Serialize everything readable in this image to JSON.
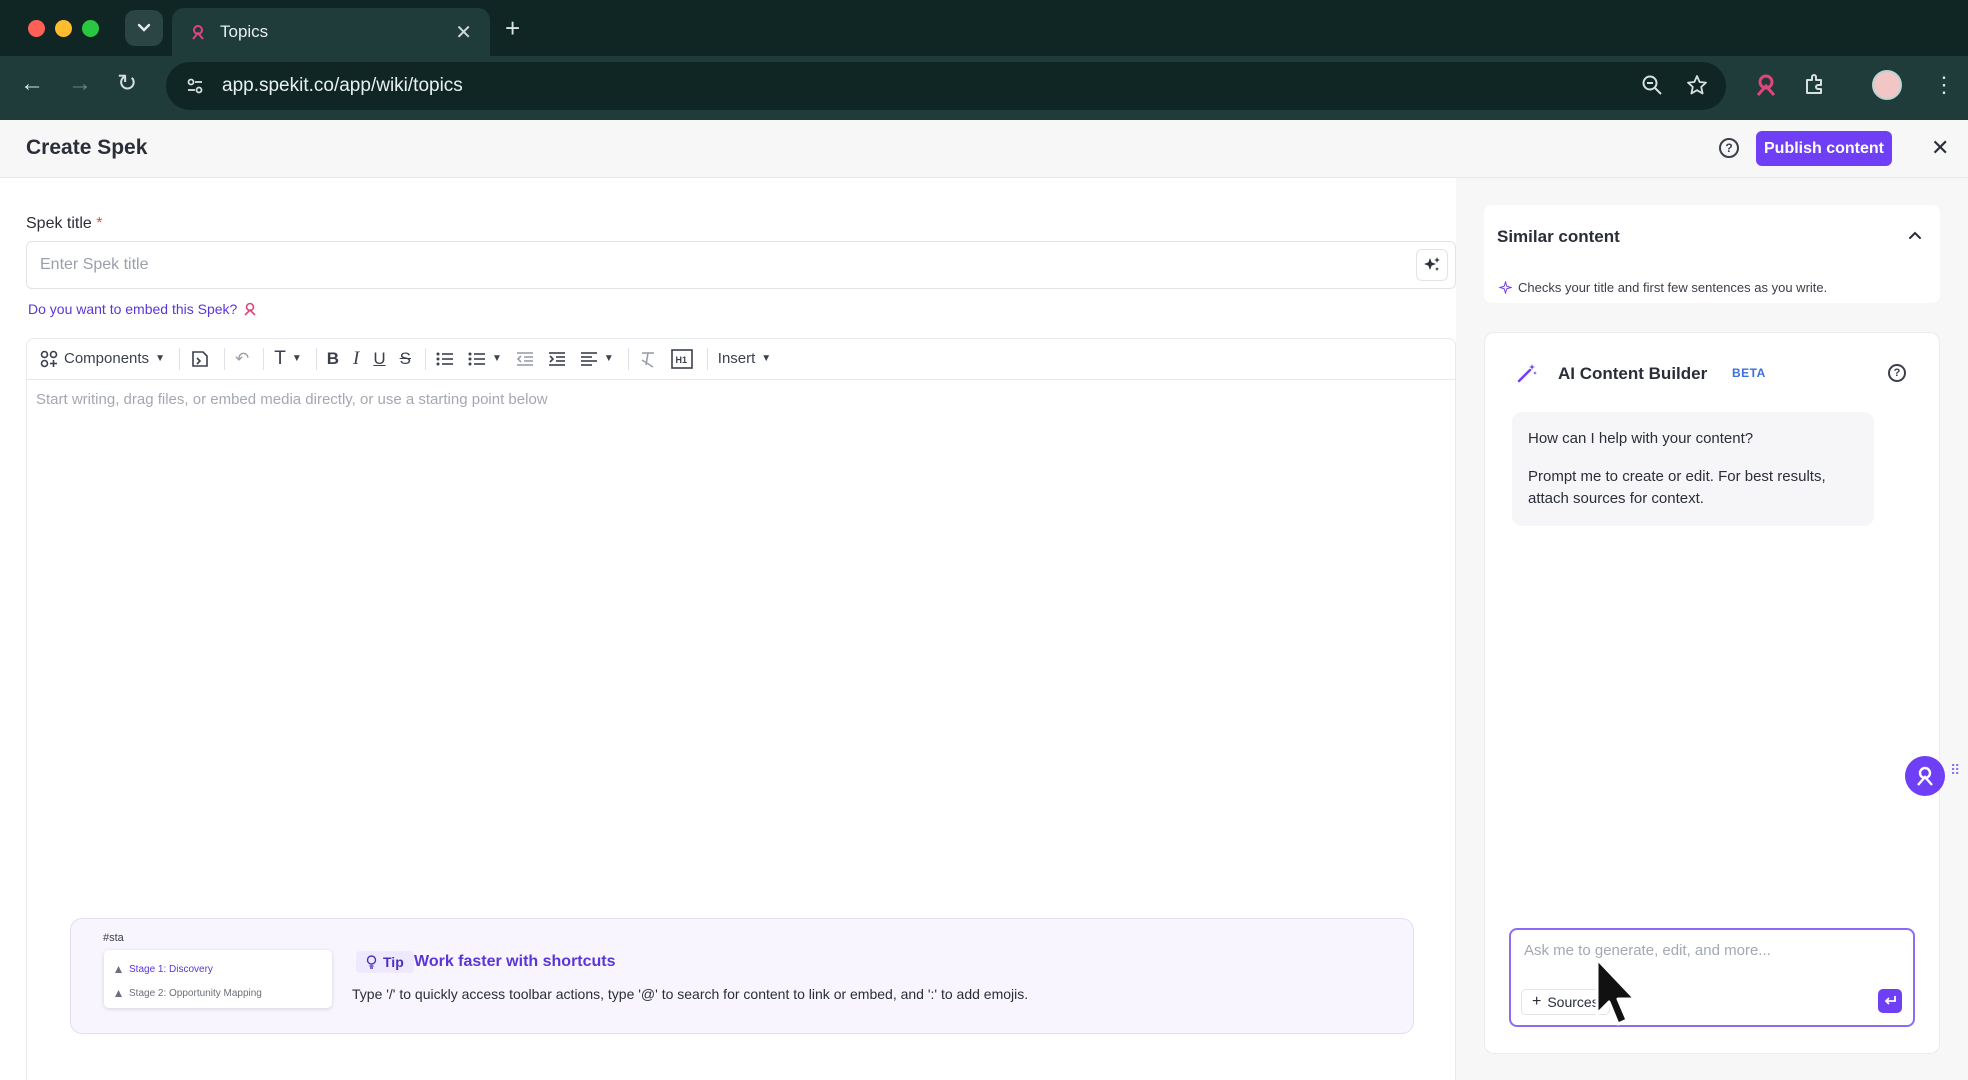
{
  "browser": {
    "tab_title": "Topics",
    "url": "app.spekit.co/app/wiki/topics"
  },
  "header": {
    "title": "Create Spek",
    "publish_label": "Publish content"
  },
  "form": {
    "title_label": "Spek title",
    "required_mark": "*",
    "title_placeholder": "Enter Spek title",
    "embed_link": "Do you want to embed this Spek?"
  },
  "toolbar": {
    "components_label": "Components",
    "insert_label": "Insert"
  },
  "editor": {
    "placeholder": "Start writing, drag files, or embed media directly, or use a starting point below"
  },
  "tip": {
    "preview_query": "#sta",
    "preview_items": [
      "Stage 1: Discovery",
      "Stage 2: Opportunity Mapping"
    ],
    "badge": "Tip",
    "title": "Work faster with shortcuts",
    "body": "Type '/' to quickly access toolbar actions, type '@' to search for content to link or embed, and ':' to add emojis."
  },
  "similar": {
    "title": "Similar content",
    "note": "Checks your title and first few sentences as you write."
  },
  "ai": {
    "title": "AI Content Builder",
    "badge": "BETA",
    "message_line1": "How can I help with your content?",
    "message_line2": "Prompt me to create or edit. For best results, attach sources for context.",
    "prompt_placeholder": "Ask me to generate, edit, and more...",
    "sources_label": "Sources"
  },
  "colors": {
    "accent": "#6f3ff5",
    "chrome": "#1f3b3a"
  }
}
